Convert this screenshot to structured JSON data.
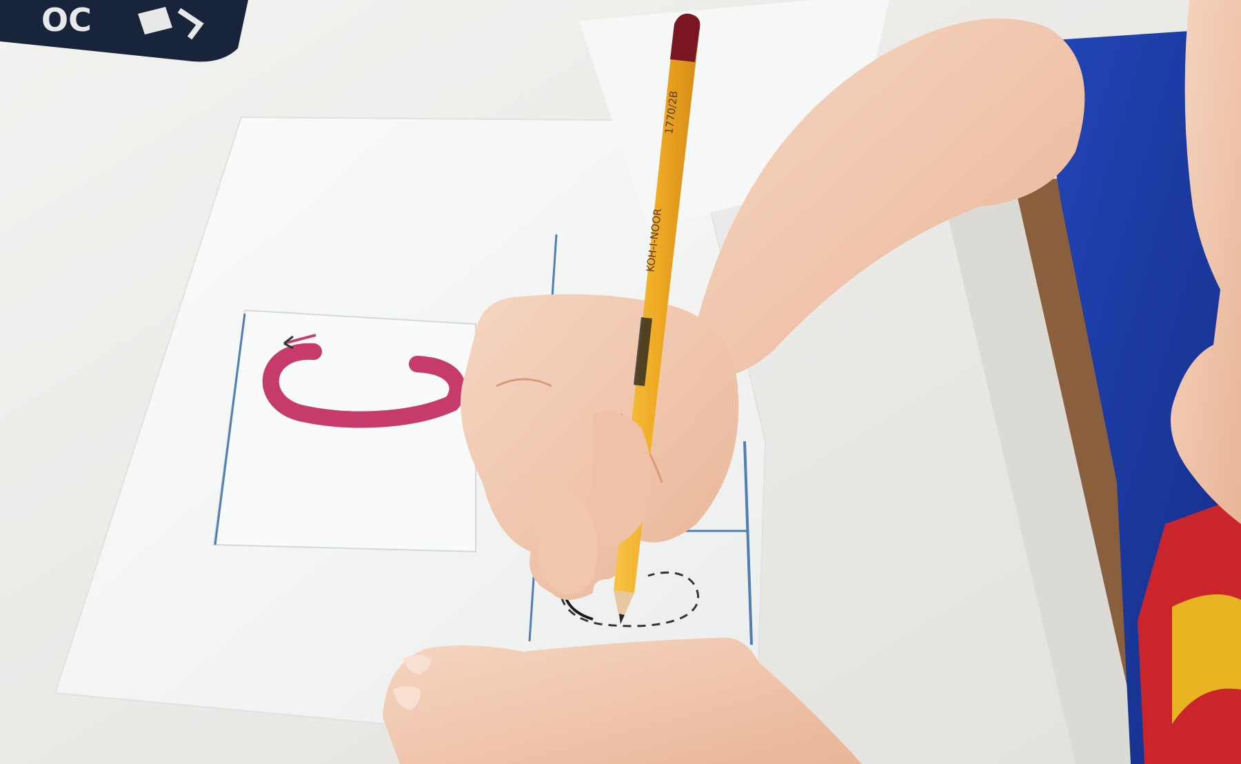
{
  "photo": {
    "subject": "child-tracing-letter-c",
    "colors": {
      "desk": "#ecebe8",
      "paper": "#f7f8f8",
      "letter_pink": "#c73a6c",
      "pencil_yellow": "#f2b32a",
      "pencil_cap": "#7a1522",
      "shirt_blue": "#1d3fae",
      "skin": "#f1c7ae",
      "guide_blue": "#4f7fb2",
      "floor": "#8a5f3e"
    }
  },
  "pencil": {
    "brand_text": "KOH-I-NOOR",
    "model_text": "1770/2B"
  },
  "pencil_case": {
    "print_text": "ОС"
  }
}
